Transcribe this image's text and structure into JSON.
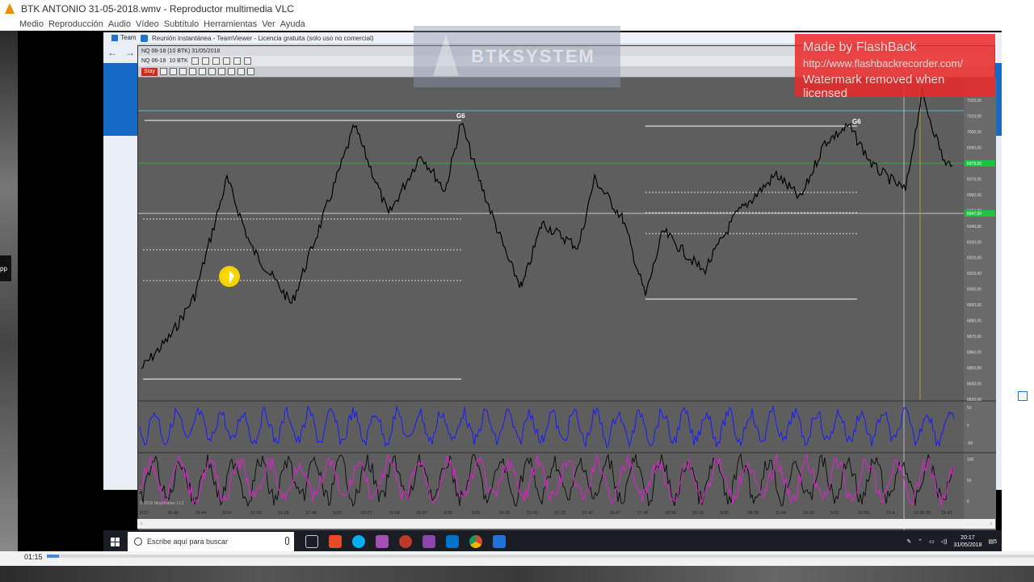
{
  "vlc": {
    "title": "BTK ANTONIO 31-05-2018.wmv - Reproductor multimedia VLC",
    "menu": [
      "Medio",
      "Reproducción",
      "Audio",
      "Vídeo",
      "Subtítulo",
      "Herramientas",
      "Ver",
      "Ayuda"
    ],
    "time": "01:15",
    "progress": 0.012
  },
  "teamviewer": {
    "title": "Reunión instantánea - TeamViewer - Licencia gratuita (solo uso no comercial)",
    "back_tab": "Team"
  },
  "chart": {
    "tab_label": "NQ 06-18 (10 BTK)  31/05/2018",
    "instrument": "NQ 06-18",
    "period": "10 BTK",
    "stay_label": "Stay",
    "copyright": "© 2018 NinjaTrader, LLC",
    "g6_label": "G6",
    "price_ticks": [
      "7020,00",
      "7010,00",
      "7000,00",
      "6990,00",
      "6980,00",
      "6970,00",
      "6960,00",
      "6950,00",
      "6940,00",
      "6930,00",
      "6920,00",
      "6910,00",
      "6900,00",
      "6890,00",
      "6880,00",
      "6870,00",
      "6860,00",
      "6850,00",
      "6840,00",
      "6830,00"
    ],
    "price_tag_green": "6979,50",
    "price_tag_green2": "6947,00",
    "time_ticks": [
      "5/23",
      "16:45",
      "18:44",
      "5/24",
      "15:50",
      "16:26",
      "17:46",
      "5/25",
      "09:27",
      "15:24",
      "16:07",
      "5/28",
      "5/29",
      "09:35",
      "12:00",
      "15:23",
      "15:42",
      "16:47",
      "17:45",
      "18:50",
      "20:15",
      "5/30",
      "08:25",
      "11:44",
      "16:00",
      "5/31",
      "13:56",
      "15:4",
      "16:38:35",
      "16:41"
    ],
    "osc1_ticks": [
      "50",
      "0",
      "-50"
    ],
    "osc2_ticks": [
      "100",
      "50",
      "0"
    ],
    "colors": {
      "osc1": "#1a1aff",
      "osc2a": "#111111",
      "osc2b": "#e020d0",
      "bg": "#5e5e5e"
    }
  },
  "watermarks": {
    "btk": "BTKSYSTEM",
    "flashback_l1": "Made by FlashBack",
    "flashback_l2": "http://www.flashbackrecorder.com/",
    "flashback_l3": "Watermark removed when licensed"
  },
  "taskbar": {
    "search_placeholder": "Escribe aquí para buscar",
    "time": "20:17",
    "date": "31/05/2018",
    "notif_count": "5"
  }
}
